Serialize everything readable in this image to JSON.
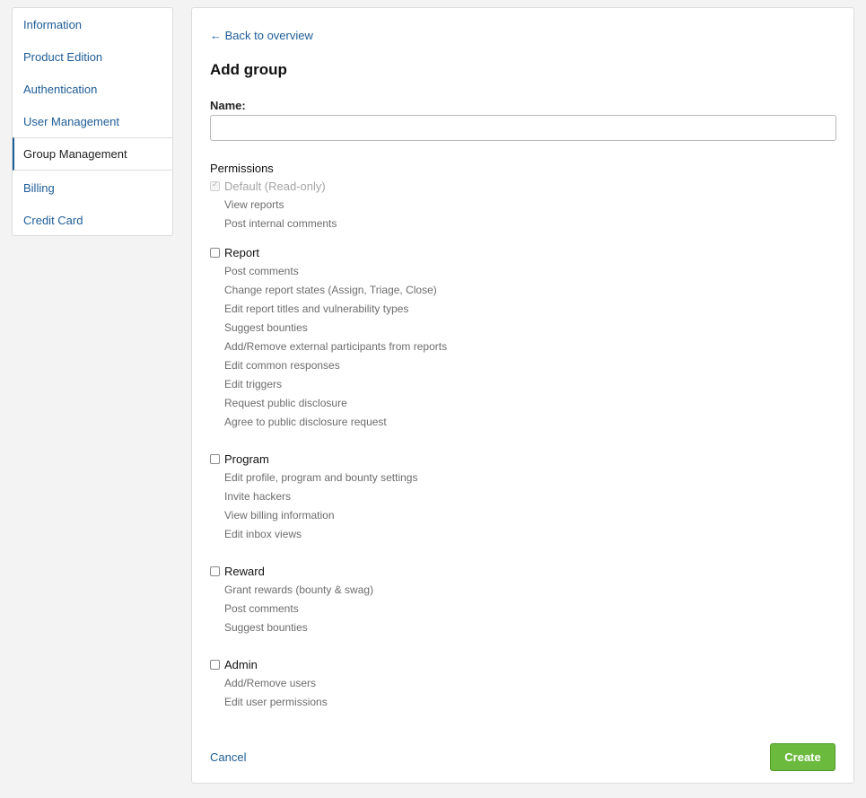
{
  "sidebar": {
    "items": [
      {
        "label": "Information",
        "active": false
      },
      {
        "label": "Product Edition",
        "active": false
      },
      {
        "label": "Authentication",
        "active": false
      },
      {
        "label": "User Management",
        "active": false
      },
      {
        "label": "Group Management",
        "active": true
      },
      {
        "label": "Billing",
        "active": false
      },
      {
        "label": "Credit Card",
        "active": false
      }
    ]
  },
  "main": {
    "back_link": "← Back to overview",
    "title": "Add group",
    "name_label": "Name:",
    "name_value": "",
    "permissions_title": "Permissions",
    "groups": [
      {
        "label": "Default (Read-only)",
        "checked": true,
        "disabled": true,
        "items": [
          "View reports",
          "Post internal comments"
        ]
      },
      {
        "label": "Report",
        "checked": false,
        "disabled": false,
        "items": [
          "Post comments",
          "Change report states (Assign, Triage, Close)",
          "Edit report titles and vulnerability types",
          "Suggest bounties",
          "Add/Remove external participants from reports",
          "Edit common responses",
          "Edit triggers",
          "Request public disclosure",
          "Agree to public disclosure request"
        ]
      },
      {
        "label": "Program",
        "checked": false,
        "disabled": false,
        "items": [
          "Edit profile, program and bounty settings",
          "Invite hackers",
          "View billing information",
          "Edit inbox views"
        ]
      },
      {
        "label": "Reward",
        "checked": false,
        "disabled": false,
        "items": [
          "Grant rewards (bounty & swag)",
          "Post comments",
          "Suggest bounties"
        ]
      },
      {
        "label": "Admin",
        "checked": false,
        "disabled": false,
        "items": [
          "Add/Remove users",
          "Edit user permissions"
        ]
      }
    ],
    "cancel_label": "Cancel",
    "create_label": "Create"
  },
  "colors": {
    "link": "#1e5c96",
    "create_button": "#6bba3e",
    "muted_text": "#6d6d6d"
  }
}
